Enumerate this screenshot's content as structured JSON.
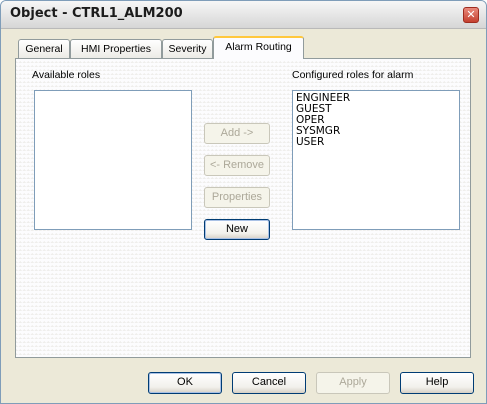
{
  "window": {
    "title": "Object - CTRL1_ALM200",
    "close_glyph": "✕"
  },
  "tabs": [
    {
      "label": "General",
      "active": false
    },
    {
      "label": "HMI Properties",
      "active": false
    },
    {
      "label": "Severity",
      "active": false
    },
    {
      "label": "Alarm Routing",
      "active": true
    }
  ],
  "available": {
    "label": "Available roles",
    "items": []
  },
  "configured": {
    "label": "Configured roles for alarm",
    "items": [
      "ENGINEER",
      "GUEST",
      "OPER",
      "SYSMGR",
      "USER"
    ]
  },
  "middle_buttons": {
    "add": "Add ->",
    "remove": "<- Remove",
    "properties": "Properties",
    "new": "New"
  },
  "footer_buttons": {
    "ok": "OK",
    "cancel": "Cancel",
    "apply": "Apply",
    "help": "Help"
  },
  "colors": {
    "active_tab_accent": "#ffc83c",
    "close_button": "#c4402f",
    "list_border": "#7f9db9"
  }
}
